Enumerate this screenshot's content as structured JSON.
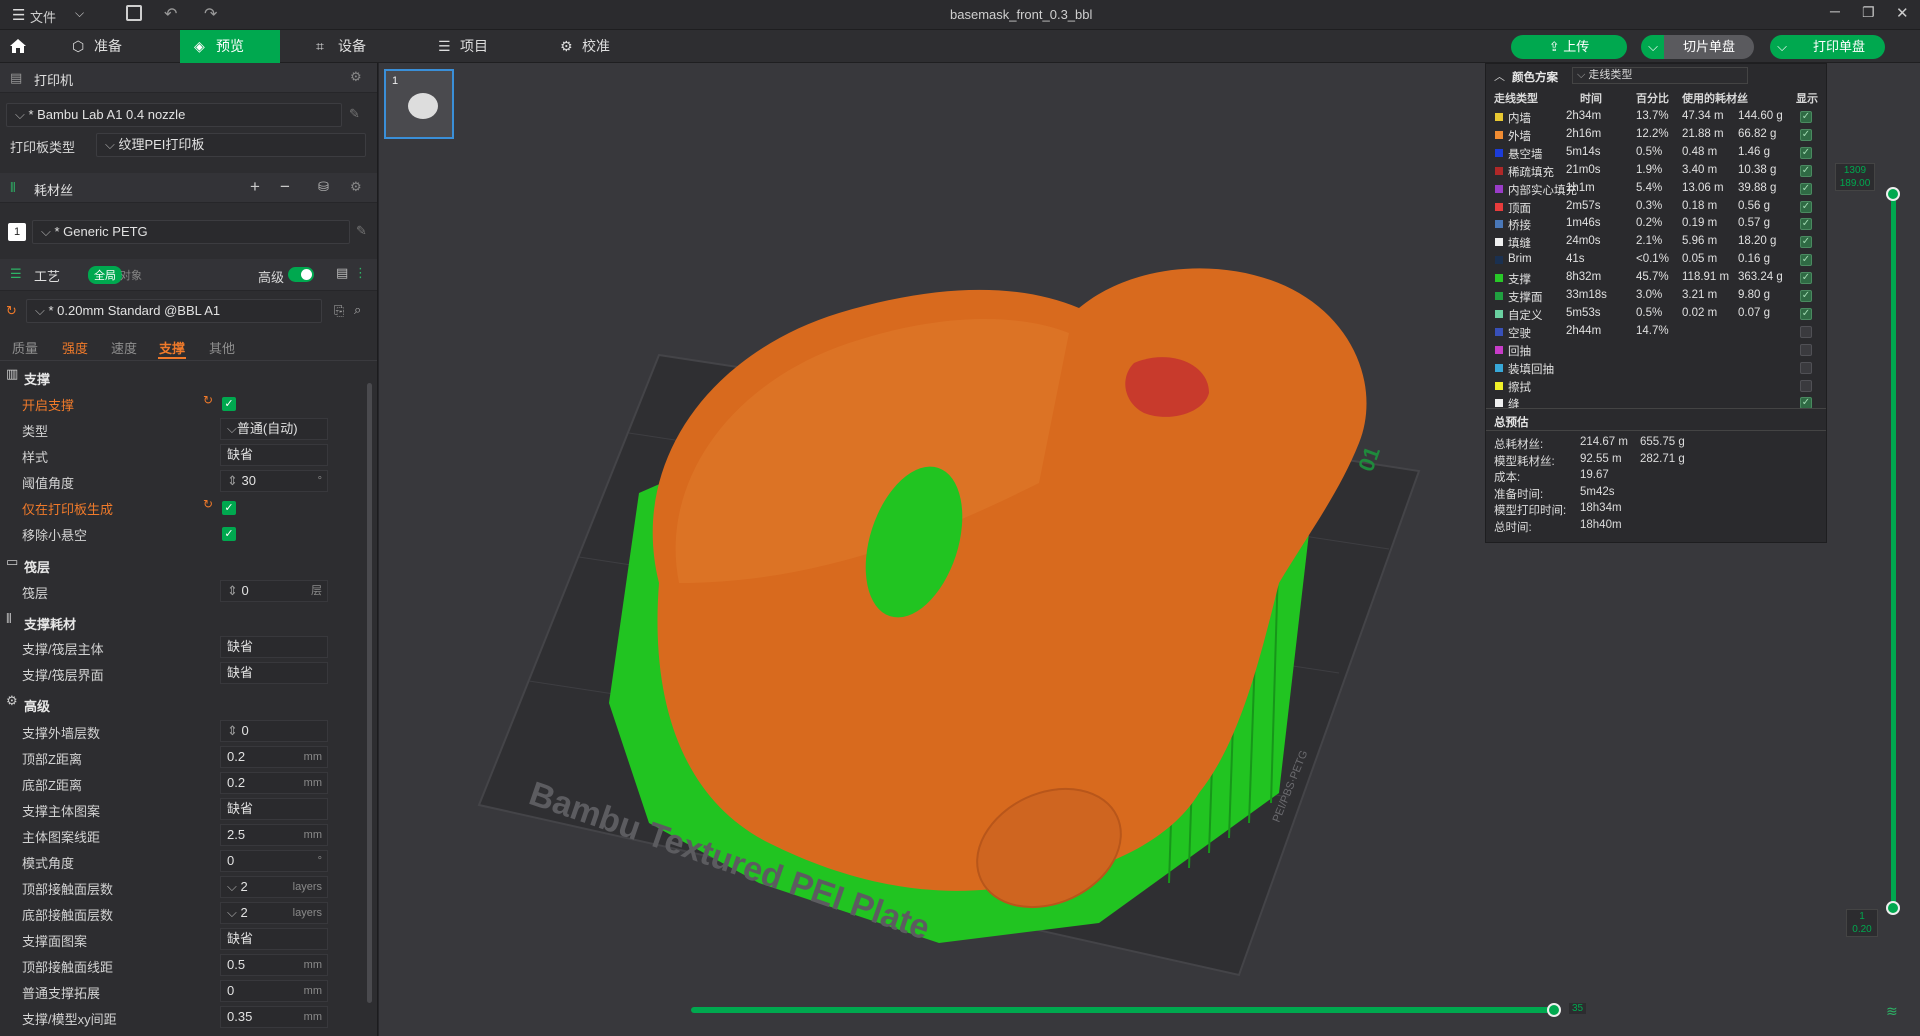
{
  "titlebar": {
    "menu": "文件",
    "title": "basemask_front_0.3_bbl"
  },
  "nav": {
    "tabs": [
      {
        "label": "准备",
        "icon": "cube-icon"
      },
      {
        "label": "预览",
        "icon": "layers-icon",
        "active": true
      },
      {
        "label": "设备",
        "icon": "device-icon"
      },
      {
        "label": "项目",
        "icon": "list-icon"
      },
      {
        "label": "校准",
        "icon": "calibrate-icon"
      }
    ],
    "upload": "上传",
    "slice": "切片单盘",
    "print": "打印单盘"
  },
  "printer": {
    "section": "打印机",
    "name": "* Bambu Lab A1 0.4 nozzle",
    "plate_label": "打印板类型",
    "plate_value": "纹理PEI打印板"
  },
  "filament": {
    "section": "耗材丝",
    "slot": "1",
    "name": "* Generic PETG"
  },
  "process": {
    "section": "工艺",
    "global": "全局",
    "object": "对象",
    "advanced": "高级",
    "preset": "* 0.20mm Standard @BBL A1",
    "subtabs": [
      "质量",
      "强度",
      "速度",
      "支撑",
      "其他"
    ]
  },
  "settings": {
    "support_group": "支撑",
    "enable_support": "开启支撑",
    "type_label": "类型",
    "type_value": "普通(自动)",
    "style_label": "样式",
    "style_value": "缺省",
    "threshold_label": "阈值角度",
    "threshold_value": "30",
    "threshold_unit": "°",
    "on_plate_label": "仅在打印板生成",
    "remove_small_label": "移除小悬空",
    "raft_group": "筏层",
    "raft_label": "筏层",
    "raft_value": "0",
    "raft_unit": "层",
    "filament_group": "支撑耗材",
    "base_label": "支撑/筏层主体",
    "base_value": "缺省",
    "iface_label": "支撑/筏层界面",
    "iface_value": "缺省",
    "adv_group": "高级",
    "wall_label": "支撑外墙层数",
    "wall_value": "0",
    "topz_label": "顶部Z距离",
    "topz_value": "0.2",
    "botz_label": "底部Z距离",
    "botz_value": "0.2",
    "pattern_label": "支撑主体图案",
    "pattern_value": "缺省",
    "spacing_label": "主体图案线距",
    "spacing_value": "2.5",
    "angle_label": "模式角度",
    "angle_value": "0",
    "angle_unit": "°",
    "topiface_label": "顶部接触面层数",
    "topiface_value": "2",
    "botiface_label": "底部接触面层数",
    "botiface_value": "2",
    "ifpattern_label": "支撑面图案",
    "ifpattern_value": "缺省",
    "ifspacing_label": "顶部接触面线距",
    "ifspacing_value": "0.5",
    "expand_label": "普通支撑拓展",
    "expand_value": "0",
    "xy_label": "支撑/模型xy间距",
    "xy_value": "0.35",
    "unit_mm": "mm",
    "unit_layers": "layers"
  },
  "thumbnail": {
    "index": "1"
  },
  "plate_text": "Bambu Textured PEI Plate",
  "plate_side": "PEI/PBS·PETG",
  "plate_num": "01",
  "vslider": {
    "top_layer": "1309",
    "top_height": "189.00",
    "bottom_layer": "1",
    "bottom_height": "0.20"
  },
  "hslider": {
    "value": "35"
  },
  "legend": {
    "scheme_label": "颜色方案",
    "scheme_value": "走线类型",
    "headers": [
      "走线类型",
      "时间",
      "百分比",
      "使用的耗材丝",
      "显示"
    ],
    "rows": [
      {
        "name": "内墙",
        "color": "#e8c832",
        "time": "2h34m",
        "pct": "13.7%",
        "len": "47.34 m",
        "wt": "144.60 g",
        "show": true
      },
      {
        "name": "外墙",
        "color": "#f08c32",
        "time": "2h16m",
        "pct": "12.2%",
        "len": "21.88 m",
        "wt": "66.82 g",
        "show": true
      },
      {
        "name": "悬空墙",
        "color": "#1c3cd8",
        "time": "5m14s",
        "pct": "0.5%",
        "len": "0.48 m",
        "wt": "1.46 g",
        "show": true
      },
      {
        "name": "稀疏填充",
        "color": "#b02828",
        "time": "21m0s",
        "pct": "1.9%",
        "len": "3.40 m",
        "wt": "10.38 g",
        "show": true
      },
      {
        "name": "内部实心填充",
        "color": "#9a3cc8",
        "time": "1h1m",
        "pct": "5.4%",
        "len": "13.06 m",
        "wt": "39.88 g",
        "show": true
      },
      {
        "name": "顶面",
        "color": "#e83c3c",
        "time": "2m57s",
        "pct": "0.3%",
        "len": "0.18 m",
        "wt": "0.56 g",
        "show": true
      },
      {
        "name": "桥接",
        "color": "#4a78b8",
        "time": "1m46s",
        "pct": "0.2%",
        "len": "0.19 m",
        "wt": "0.57 g",
        "show": true
      },
      {
        "name": "填缝",
        "color": "#f0f0f0",
        "time": "24m0s",
        "pct": "2.1%",
        "len": "5.96 m",
        "wt": "18.20 g",
        "show": true
      },
      {
        "name": "Brim",
        "color": "#1a3050",
        "time": "41s",
        "pct": "<0.1%",
        "len": "0.05 m",
        "wt": "0.16 g",
        "show": true
      },
      {
        "name": "支撑",
        "color": "#28c828",
        "time": "8h32m",
        "pct": "45.7%",
        "len": "118.91 m",
        "wt": "363.24 g",
        "show": true
      },
      {
        "name": "支撑面",
        "color": "#20a040",
        "time": "33m18s",
        "pct": "3.0%",
        "len": "3.21 m",
        "wt": "9.80 g",
        "show": true
      },
      {
        "name": "自定义",
        "color": "#6ad0a0",
        "time": "5m53s",
        "pct": "0.5%",
        "len": "0.02 m",
        "wt": "0.07 g",
        "show": true
      },
      {
        "name": "空驶",
        "color": "#3850b8",
        "time": "2h44m",
        "pct": "14.7%",
        "len": "",
        "wt": "",
        "show": false
      },
      {
        "name": "回抽",
        "color": "#c83cc8",
        "time": "",
        "pct": "",
        "len": "",
        "wt": "",
        "show": false
      },
      {
        "name": "装填回抽",
        "color": "#38a8d8",
        "time": "",
        "pct": "",
        "len": "",
        "wt": "",
        "show": false
      },
      {
        "name": "擦拭",
        "color": "#f0f028",
        "time": "",
        "pct": "",
        "len": "",
        "wt": "",
        "show": false
      },
      {
        "name": "缝",
        "color": "#f0f0f0",
        "time": "",
        "pct": "",
        "len": "",
        "wt": "",
        "show": true
      }
    ],
    "summary_title": "总预估",
    "summary": [
      {
        "label": "总耗材丝:",
        "a": "214.67 m",
        "b": "655.75 g"
      },
      {
        "label": "模型耗材丝:",
        "a": "92.55 m",
        "b": "282.71 g"
      },
      {
        "label": "成本:",
        "a": "19.67",
        "b": ""
      },
      {
        "label": "准备时间:",
        "a": "5m42s",
        "b": ""
      },
      {
        "label": "模型打印时间:",
        "a": "18h34m",
        "b": ""
      },
      {
        "label": "总时间:",
        "a": "18h40m",
        "b": ""
      }
    ]
  },
  "colors": {
    "accent": "#00a84f",
    "orange": "#f07a2a",
    "model": "#d86a1e",
    "support": "#21c421"
  }
}
